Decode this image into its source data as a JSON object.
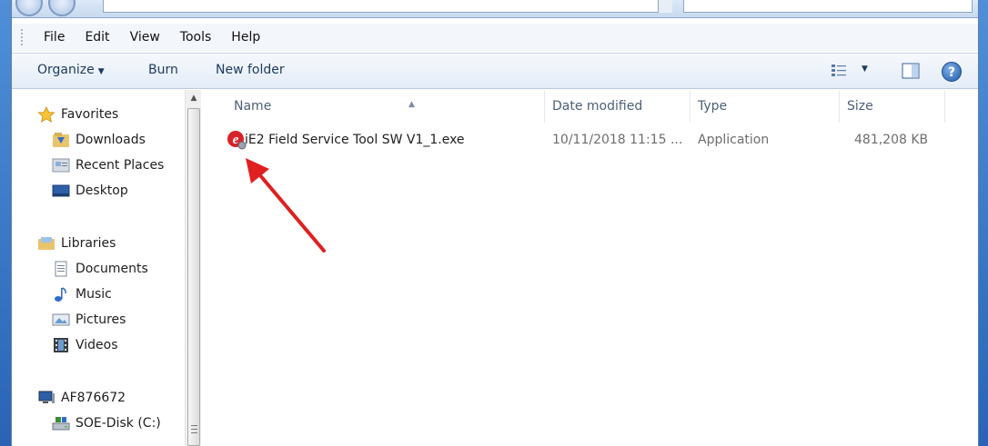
{
  "menu": [
    "File",
    "Edit",
    "View",
    "Tools",
    "Help"
  ],
  "toolbar": {
    "organize": "Organize",
    "burn": "Burn",
    "new_folder": "New folder",
    "help_glyph": "?"
  },
  "nav": {
    "favorites": {
      "label": "Favorites",
      "icon": "star-icon"
    },
    "favorites_items": [
      {
        "label": "Downloads",
        "icon": "downloads-folder-icon"
      },
      {
        "label": "Recent Places",
        "icon": "recent-places-icon"
      },
      {
        "label": "Desktop",
        "icon": "desktop-icon"
      }
    ],
    "libraries": {
      "label": "Libraries",
      "icon": "libraries-icon"
    },
    "libraries_items": [
      {
        "label": "Documents",
        "icon": "documents-icon"
      },
      {
        "label": "Music",
        "icon": "music-icon"
      },
      {
        "label": "Pictures",
        "icon": "pictures-icon"
      },
      {
        "label": "Videos",
        "icon": "videos-icon"
      }
    ],
    "computer": {
      "label": "AF876672",
      "icon": "computer-icon"
    },
    "computer_items": [
      {
        "label": "SOE-Disk (C:)",
        "icon": "drive-icon"
      }
    ]
  },
  "columns": {
    "name": "Name",
    "date": "Date modified",
    "type": "Type",
    "size": "Size"
  },
  "files": [
    {
      "name": "iE2 Field Service Tool SW V1_1.exe",
      "date": "10/11/2018 11:15 ...",
      "type": "Application",
      "size": "481,208 KB",
      "icon": "application-e-icon"
    }
  ],
  "colors": {
    "annotation_arrow": "#e02020",
    "accent": "#1f5aa8"
  }
}
